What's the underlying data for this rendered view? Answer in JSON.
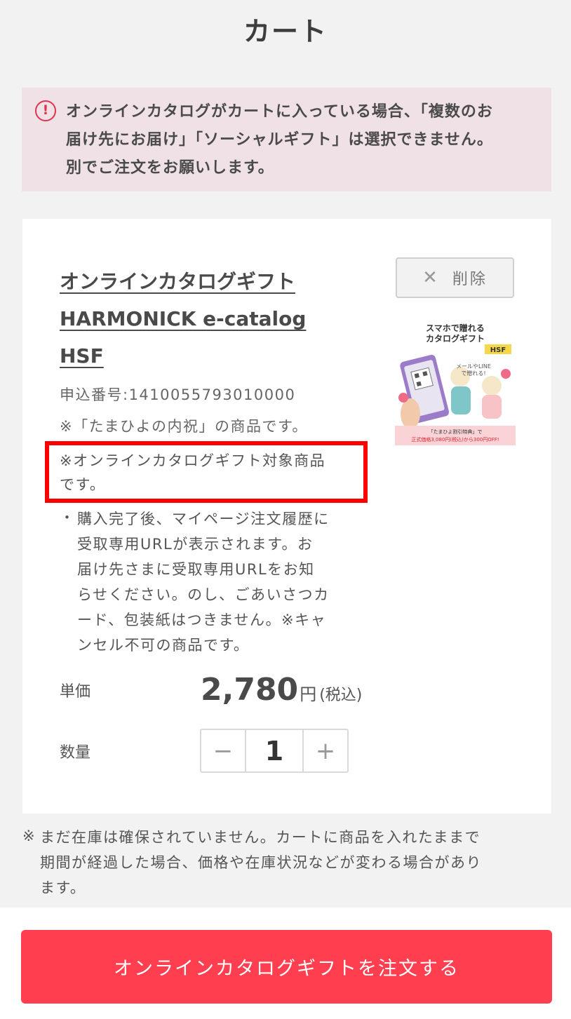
{
  "page": {
    "title": "カート"
  },
  "alert": {
    "icon": "exclamation-circle-icon",
    "line1": "オンラインカタログがカートに入っている場合、「複数のお",
    "line2": "届け先にお届け」「ソーシャルギフト」は選択できません。",
    "line3": "別でご注文をお願いします。"
  },
  "item": {
    "title_line1": "オンラインカタログギフト",
    "title_line2": "HARMONICK e-catalog",
    "title_line3": "HSF",
    "delete_label": "削除",
    "order_number": "申込番号:1410055793010000",
    "note_brand": "※「たまひよの内祝」の商品です。",
    "note_catalog_line1": "※オンラインカタログギフト対象商品",
    "note_catalog_line2": "です。",
    "bullet_mark": "・",
    "bullet_lines": [
      "購入完了後、マイページ注文履歴に",
      "受取専用URLが表示されます。お",
      "届け先さまに受取専用URLをお知",
      "らせください。のし、ごあいさつカ",
      "ード、包装紙はつきません。※キャ",
      "ンセル不可の商品です。"
    ],
    "price_label": "単価",
    "price_value": "2,780",
    "price_unit": "円",
    "price_tax": "(税込)",
    "quantity_label": "数量",
    "quantity_value": "1",
    "minus_symbol": "−",
    "plus_symbol": "+",
    "image": {
      "headline_line1": "スマホで贈れる",
      "headline_line2": "カタログギフト",
      "badge": "HSF",
      "bubble_line1": "メールやLINE",
      "bubble_line2": "で贈れる!",
      "banner_line1": "「たまひよ割引特典」で",
      "banner_line2": "正式価格3,080円(税込)から300円OFF!"
    }
  },
  "stock_note": {
    "mark": "※",
    "line1": "まだ在庫は確保されていません。カートに商品を入れたままで",
    "line2": "期間が経過した場合、価格や在庫状況などが変わる場合があり",
    "line3": "ます。"
  },
  "footer": {
    "order_button_label": "オンラインカタログギフトを注文する"
  },
  "colors": {
    "accent": "#ff3f4f",
    "alert_bg": "#efe1e5",
    "alert_icon": "#e0334e",
    "highlight": "#ff0000"
  }
}
